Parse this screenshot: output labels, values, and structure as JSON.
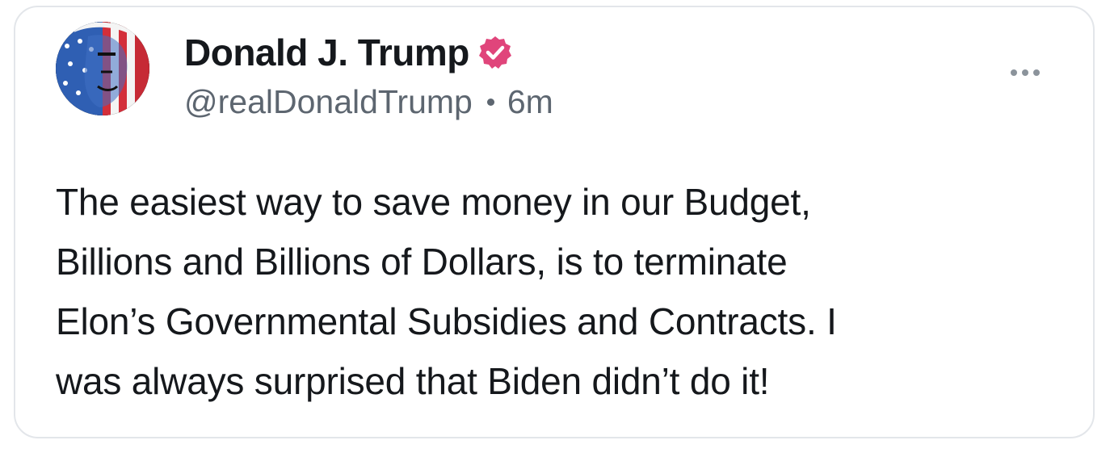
{
  "post": {
    "author": {
      "display_name": "Donald J. Trump",
      "handle": "@realDonaldTrump",
      "verified": true,
      "verified_color": "#e0457b",
      "avatar_icon": "profile-photo-flag-portrait"
    },
    "timestamp": "6m",
    "separator": "•",
    "more_icon": "ellipsis-horizontal-icon",
    "body_lines": [
      "The easiest way to save money in our Budget,",
      "Billions and Billions of Dollars, is to terminate",
      "Elon’s Governmental Subsidies and Contracts. I",
      "was always surprised that Biden didn’t do it!"
    ]
  },
  "colors": {
    "text": "#15181c",
    "muted": "#5d6670",
    "border": "#e3e6ea",
    "background": "#ffffff"
  }
}
